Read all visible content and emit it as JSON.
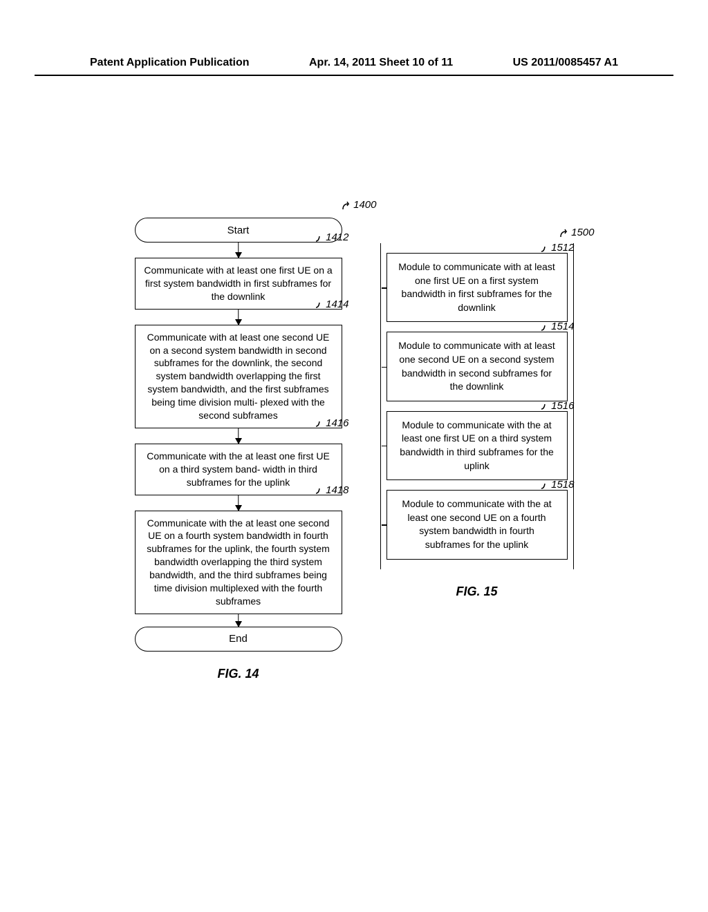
{
  "header": {
    "left": "Patent Application Publication",
    "center": "Apr. 14, 2011  Sheet 10 of 11",
    "right": "US 2011/0085457 A1"
  },
  "flowchart": {
    "ref_main": "1400",
    "start": "Start",
    "end": "End",
    "caption": "FIG. 14",
    "steps": [
      {
        "ref": "1412",
        "text": "Communicate with at least one first UE on a first system bandwidth in first subframes for the downlink"
      },
      {
        "ref": "1414",
        "text": "Communicate with at least one second UE on a second system bandwidth in second subframes for the downlink, the second system bandwidth overlapping the first system bandwidth, and the first subframes being time division multi- plexed with the second subframes"
      },
      {
        "ref": "1416",
        "text": "Communicate with the at least one first UE on a third system band- width in third subframes for the uplink"
      },
      {
        "ref": "1418",
        "text": "Communicate with the at least one second UE on a fourth system bandwidth in fourth subframes for the uplink, the fourth system bandwidth overlapping the third system bandwidth, and the third subframes being time division multiplexed with the fourth subframes"
      }
    ]
  },
  "modules": {
    "ref_main": "1500",
    "caption": "FIG. 15",
    "items": [
      {
        "ref": "1512",
        "text": "Module to communicate with at least one first UE on a first system bandwidth in first subframes for the downlink"
      },
      {
        "ref": "1514",
        "text": "Module to communicate with at least one second UE on a second system bandwidth in second subframes for the downlink"
      },
      {
        "ref": "1516",
        "text": "Module to communicate with the at least one first UE on a third system bandwidth in third subframes for the uplink"
      },
      {
        "ref": "1518",
        "text": "Module to communicate with the at least one second UE on a fourth system bandwidth in fourth subframes for the uplink"
      }
    ]
  }
}
